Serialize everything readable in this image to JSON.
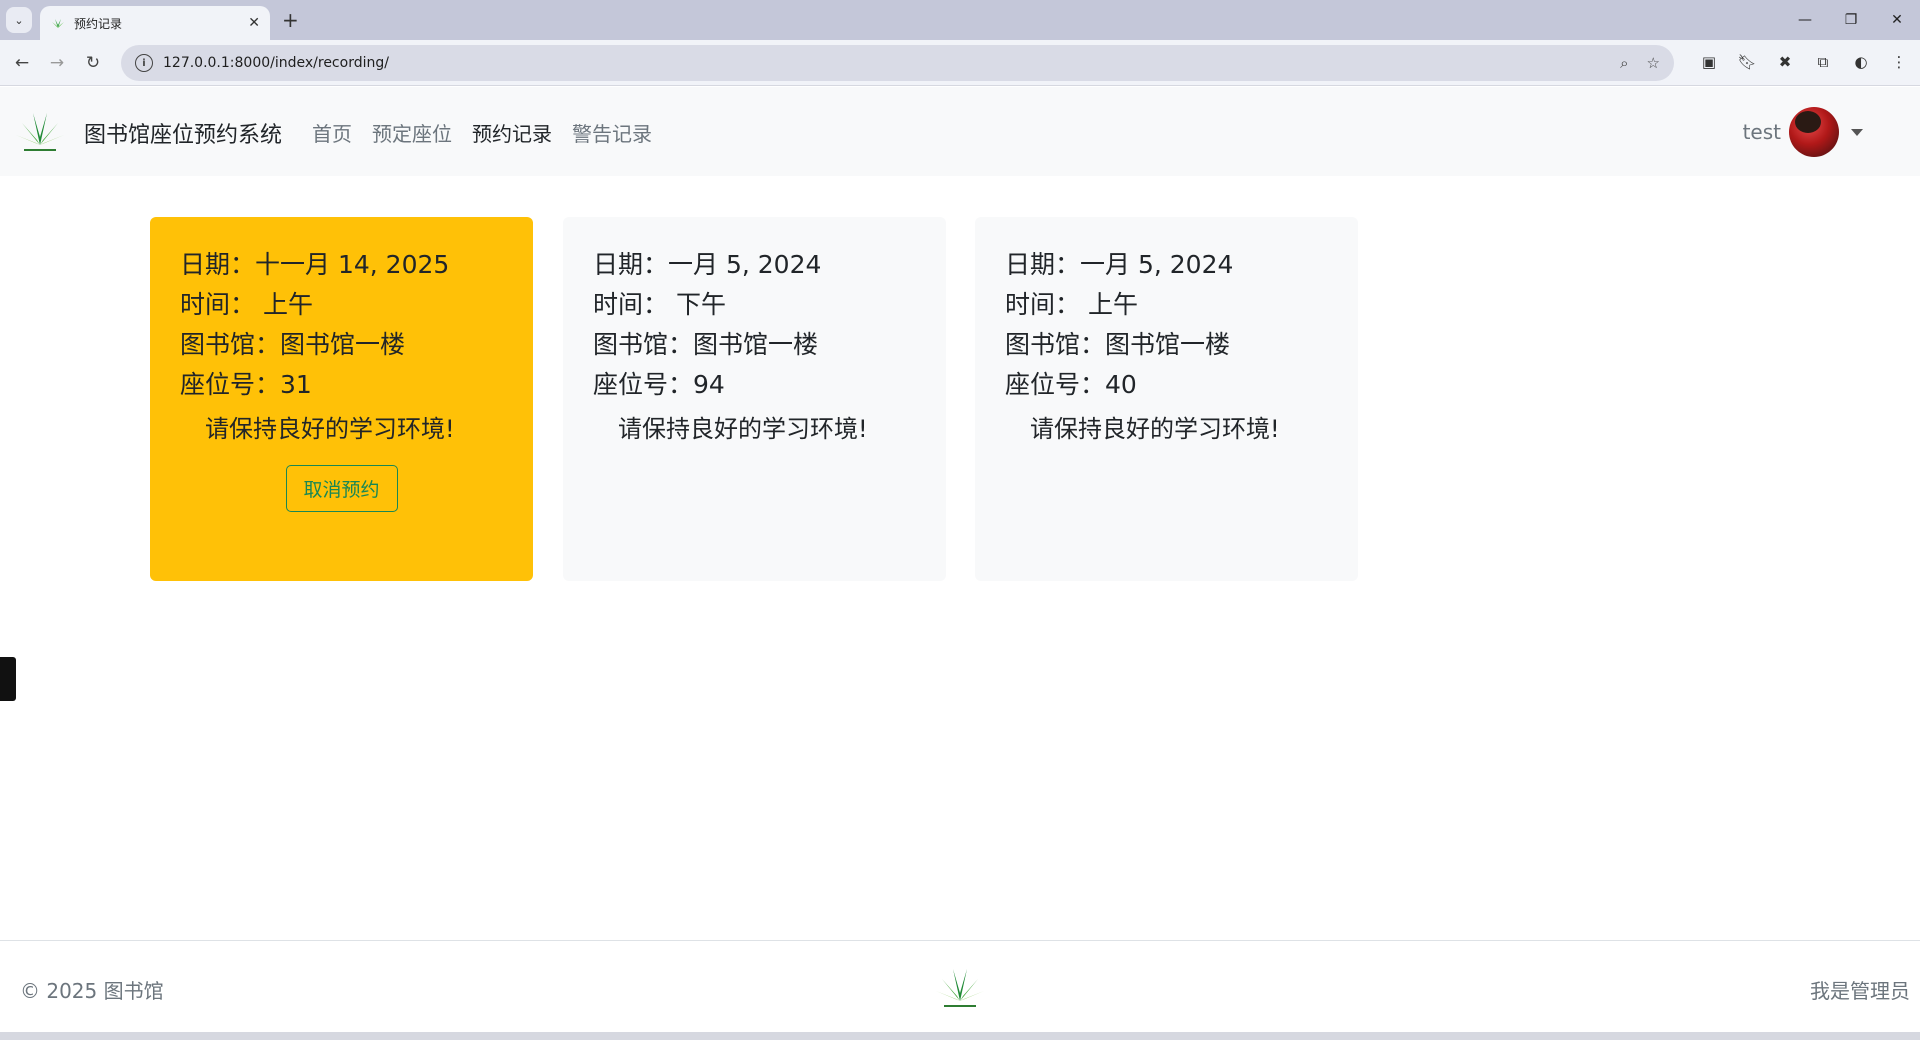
{
  "browser": {
    "tab_title": "预约记录",
    "url": "127.0.0.1:8000/index/recording/"
  },
  "site": {
    "brand": "图书馆座位预约系统",
    "nav": [
      "首页",
      "预定座位",
      "预约记录",
      "警告记录"
    ],
    "active_nav_index": 2,
    "username": "test"
  },
  "records": [
    {
      "date_label": "日期：",
      "date": "十一月 14, 2025",
      "time_label": "时间：",
      "time": "上午",
      "library_label": "图书馆：",
      "library": "图书馆一楼",
      "seat_label": "座位号：",
      "seat": "31",
      "note": "请保持良好的学习环境!",
      "cancel_label": "取消预约",
      "highlight_color": "#ffc107"
    },
    {
      "date_label": "日期：",
      "date": "一月 5, 2024",
      "time_label": "时间：",
      "time": "下午",
      "library_label": "图书馆：",
      "library": "图书馆一楼",
      "seat_label": "座位号：",
      "seat": "94",
      "note": "请保持良好的学习环境!"
    },
    {
      "date_label": "日期：",
      "date": "一月 5, 2024",
      "time_label": "时间：",
      "time": "上午",
      "library_label": "图书馆：",
      "library": "图书馆一楼",
      "seat_label": "座位号：",
      "seat": "40",
      "note": "请保持良好的学习环境!"
    }
  ],
  "footer": {
    "copyright": "© 2025 图书馆",
    "admin_link": "我是管理员"
  }
}
